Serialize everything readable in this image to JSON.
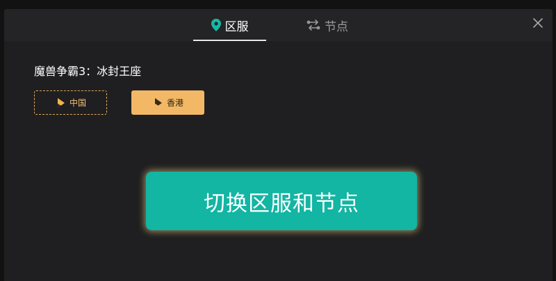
{
  "tabs": [
    {
      "label": "区服",
      "icon": "location-pin-icon",
      "active": true
    },
    {
      "label": "节点",
      "icon": "swap-arrows-icon",
      "active": false
    }
  ],
  "game": {
    "title": "魔兽争霸3：冰封王座"
  },
  "regions": [
    {
      "label": "中国",
      "icon": "play-icon",
      "state": "outlined"
    },
    {
      "label": "香港",
      "icon": "play-icon",
      "state": "selected"
    }
  ],
  "action": {
    "switch_label": "切换区服和节点"
  },
  "colors": {
    "accent_teal": "#13b5a3",
    "accent_gold": "#f3b866",
    "dialog_bg": "#1f1f21"
  }
}
